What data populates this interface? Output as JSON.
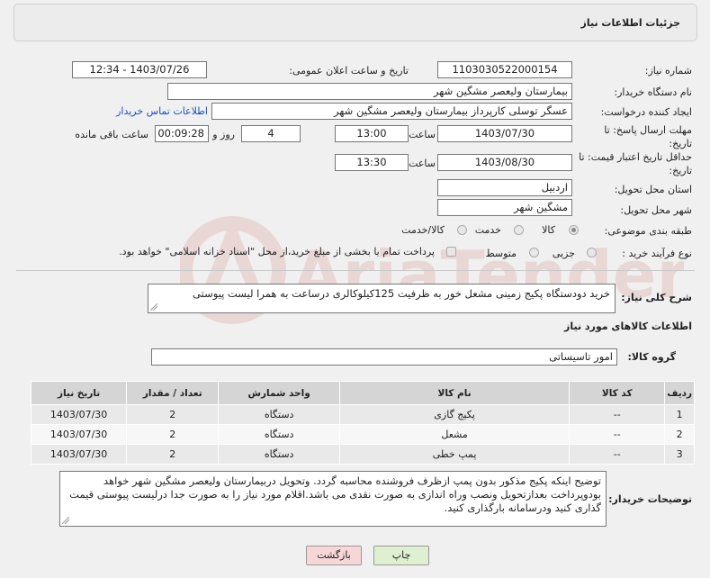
{
  "header": {
    "title": "جزئیات اطلاعات نیاز"
  },
  "form": {
    "need_number_label": "شماره نیاز:",
    "need_number": "1103030522000154",
    "announce_label": "تاریخ و ساعت اعلان عمومی:",
    "announce_value": "1403/07/26 - 12:34",
    "buyer_org_label": "نام دستگاه خریدار:",
    "buyer_org": "بیمارستان ولیعصر مشگین شهر",
    "creator_label": "ایجاد کننده درخواست:",
    "creator": "عسگر توسلی کارپرداز بیمارستان ولیعصر مشگین شهر",
    "contact_link": "اطلاعات تماس خریدار",
    "deadline_label_1": "مهلت ارسال پاسخ: تا",
    "deadline_label_2": "تاریخ:",
    "deadline_date": "1403/07/30",
    "time_label": "ساعت",
    "deadline_time": "13:00",
    "days_value": "4",
    "days_label": "روز و",
    "remaining_value": "00:09:28",
    "remaining_label": "ساعت باقی مانده",
    "validity_label_1": "حداقل تاریخ اعتبار قیمت: تا",
    "validity_label_2": "تاریخ:",
    "validity_date": "1403/08/30",
    "validity_time": "13:30",
    "province_label": "استان محل تحویل:",
    "province": "اردبیل",
    "city_label": "شهر محل تحویل:",
    "city": "مشگین شهر",
    "category_label": "طبقه بندی موضوعی:",
    "category_options": [
      "کالا",
      "خدمت",
      "کالا/خدمت"
    ],
    "category_selected": "کالا",
    "process_label": "نوع فرآیند خرید :",
    "process_options": [
      "جزیی",
      "متوسط"
    ],
    "payment_note": "پرداخت تمام یا بخشی از مبلغ خرید،از محل \"اسناد خزانه اسلامی\" خواهد بود."
  },
  "summary": {
    "label": "شرح کلی نیاز:",
    "text": "خرید دودستگاه پکیج زمینی مشعل خور به ظرفیت 125کیلوکالری درساعت به همرا لیست پیوستی"
  },
  "goods": {
    "section_title": "اطلاعات کالاهای مورد نیاز",
    "group_label": "گروه کالا:",
    "group_value": "امور تاسیساتی",
    "columns": [
      "ردیف",
      "کد کالا",
      "نام کالا",
      "واحد شمارش",
      "تعداد / مقدار",
      "تاریخ نیاز"
    ],
    "rows": [
      [
        "1",
        "--",
        "پکیج گازی",
        "دستگاه",
        "2",
        "1403/07/30"
      ],
      [
        "2",
        "--",
        "مشعل",
        "دستگاه",
        "2",
        "1403/07/30"
      ],
      [
        "3",
        "--",
        "پمپ خطی",
        "دستگاه",
        "2",
        "1403/07/30"
      ]
    ]
  },
  "buyer_notes": {
    "label": "توضیحات خریدار:",
    "text": "توضیح اینکه پکیج مذکور بدون پمپ ازظرف فروشنده محاسبه گردد. وتحویل دربیمارستان ولیعصر مشگین شهر خواهد بودوپرداخت بعدازتحویل ونصب وراه اندازی به صورت نقدی می باشد.اقلام مورد نیاز را به صورت جدا درلیست پیوستی قیمت گذاری کنید ودرسامانه بارگذاری کنید."
  },
  "buttons": {
    "print": "چاپ",
    "back": "بازگشت"
  },
  "watermark": {
    "text": "AriaTender.neT"
  }
}
